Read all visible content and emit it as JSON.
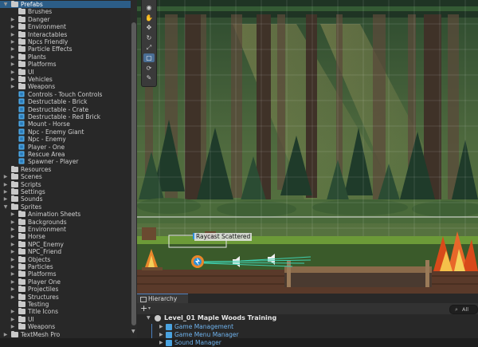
{
  "project": {
    "rows": [
      {
        "label": "Prefabs",
        "type": "folder",
        "indent": 0,
        "expand": "open",
        "selected": true
      },
      {
        "label": "Brushes",
        "type": "folder",
        "indent": 1,
        "expand": "none"
      },
      {
        "label": "Danger",
        "type": "folder",
        "indent": 1,
        "expand": "closed"
      },
      {
        "label": "Environment",
        "type": "folder",
        "indent": 1,
        "expand": "closed"
      },
      {
        "label": "Interactables",
        "type": "folder",
        "indent": 1,
        "expand": "closed"
      },
      {
        "label": "Npcs Friendly",
        "type": "folder",
        "indent": 1,
        "expand": "closed"
      },
      {
        "label": "Particle Effects",
        "type": "folder",
        "indent": 1,
        "expand": "closed"
      },
      {
        "label": "Plants",
        "type": "folder",
        "indent": 1,
        "expand": "closed"
      },
      {
        "label": "Platforms",
        "type": "folder",
        "indent": 1,
        "expand": "closed"
      },
      {
        "label": "UI",
        "type": "folder",
        "indent": 1,
        "expand": "closed"
      },
      {
        "label": "Vehicles",
        "type": "folder",
        "indent": 1,
        "expand": "closed"
      },
      {
        "label": "Weapons",
        "type": "folder",
        "indent": 1,
        "expand": "closed"
      },
      {
        "label": "Controls - Touch Controls",
        "type": "prefab",
        "indent": 1,
        "expand": "none"
      },
      {
        "label": "Destructable - Brick",
        "type": "prefab",
        "indent": 1,
        "expand": "none"
      },
      {
        "label": "Destructable - Crate",
        "type": "prefab",
        "indent": 1,
        "expand": "none"
      },
      {
        "label": "Destructable - Red Brick",
        "type": "prefab",
        "indent": 1,
        "expand": "none"
      },
      {
        "label": "Mount - Horse",
        "type": "prefab",
        "indent": 1,
        "expand": "none"
      },
      {
        "label": "Npc - Enemy Giant",
        "type": "prefab",
        "indent": 1,
        "expand": "none"
      },
      {
        "label": "Npc - Enemy",
        "type": "prefab",
        "indent": 1,
        "expand": "none"
      },
      {
        "label": "Player - One",
        "type": "prefab",
        "indent": 1,
        "expand": "none"
      },
      {
        "label": "Rescue Area",
        "type": "prefab",
        "indent": 1,
        "expand": "none"
      },
      {
        "label": "Spawner - Player",
        "type": "prefab",
        "indent": 1,
        "expand": "none"
      },
      {
        "label": "Resources",
        "type": "folder",
        "indent": 0,
        "expand": "none"
      },
      {
        "label": "Scenes",
        "type": "folder",
        "indent": 0,
        "expand": "closed"
      },
      {
        "label": "Scripts",
        "type": "folder",
        "indent": 0,
        "expand": "closed"
      },
      {
        "label": "Settings",
        "type": "folder",
        "indent": 0,
        "expand": "closed"
      },
      {
        "label": "Sounds",
        "type": "folder",
        "indent": 0,
        "expand": "closed"
      },
      {
        "label": "Sprites",
        "type": "folder",
        "indent": 0,
        "expand": "open"
      },
      {
        "label": "Animation Sheets",
        "type": "folder",
        "indent": 1,
        "expand": "closed"
      },
      {
        "label": "Backgrounds",
        "type": "folder",
        "indent": 1,
        "expand": "closed"
      },
      {
        "label": "Environment",
        "type": "folder",
        "indent": 1,
        "expand": "closed"
      },
      {
        "label": "Horse",
        "type": "folder",
        "indent": 1,
        "expand": "closed"
      },
      {
        "label": "NPC_Enemy",
        "type": "folder",
        "indent": 1,
        "expand": "closed"
      },
      {
        "label": "NPC_Friend",
        "type": "folder",
        "indent": 1,
        "expand": "closed"
      },
      {
        "label": "Objects",
        "type": "folder",
        "indent": 1,
        "expand": "closed"
      },
      {
        "label": "Particles",
        "type": "folder",
        "indent": 1,
        "expand": "closed"
      },
      {
        "label": "Platforms",
        "type": "folder",
        "indent": 1,
        "expand": "closed"
      },
      {
        "label": "Player One",
        "type": "folder",
        "indent": 1,
        "expand": "closed"
      },
      {
        "label": "Projectiles",
        "type": "folder",
        "indent": 1,
        "expand": "closed"
      },
      {
        "label": "Structures",
        "type": "folder",
        "indent": 1,
        "expand": "closed"
      },
      {
        "label": "Testing",
        "type": "folder",
        "indent": 1,
        "expand": "none"
      },
      {
        "label": "Title Icons",
        "type": "folder",
        "indent": 1,
        "expand": "closed"
      },
      {
        "label": "UI",
        "type": "folder",
        "indent": 1,
        "expand": "closed"
      },
      {
        "label": "Weapons",
        "type": "folder",
        "indent": 1,
        "expand": "closed"
      },
      {
        "label": "TextMesh Pro",
        "type": "folder",
        "indent": 0,
        "expand": "closed"
      }
    ]
  },
  "scene": {
    "raycast_label": "Raycast Scattered",
    "tools": [
      {
        "name": "view-tool",
        "glyph": "◉",
        "active": false
      },
      {
        "name": "hand-tool",
        "glyph": "✋",
        "active": false
      },
      {
        "name": "move-tool",
        "glyph": "✥",
        "active": false
      },
      {
        "name": "rotate-tool",
        "glyph": "↻",
        "active": false
      },
      {
        "name": "scale-tool",
        "glyph": "⤢",
        "active": false
      },
      {
        "name": "rect-tool",
        "glyph": "▢",
        "active": true
      },
      {
        "name": "transform-tool",
        "glyph": "⟳",
        "active": false
      },
      {
        "name": "custom-tool",
        "glyph": "✎",
        "active": false
      }
    ]
  },
  "hierarchy": {
    "tab_label": "Hierarchy",
    "add_label": "+",
    "add_dropdown": "▾",
    "search_text": "All",
    "scene_name": "Level_01 Maple Woods Training",
    "children": [
      "Game Management",
      "Game Menu Manager",
      "Sound Manager"
    ]
  },
  "colors": {
    "selection": "#2c5d87",
    "prefab_blue": "#4aa3e0",
    "hierarchy_child": "#6fb3ee"
  }
}
